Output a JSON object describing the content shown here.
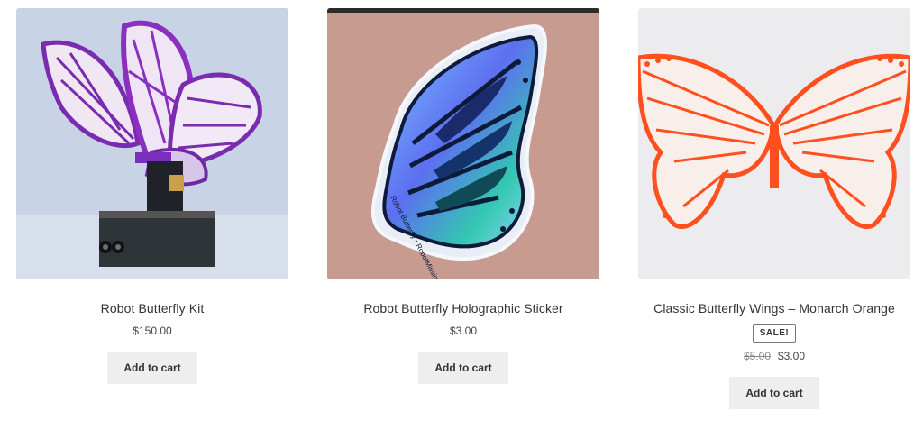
{
  "products": [
    {
      "title": "Robot Butterfly Kit",
      "price": "$150.00",
      "button_label": "Add to cart",
      "image_icon": "robot-butterfly-kit-photo"
    },
    {
      "title": "Robot Butterfly Holographic Sticker",
      "price": "$3.00",
      "button_label": "Add to cart",
      "image_icon": "holographic-sticker-photo",
      "sticker_text": "Robot Butterfly • RobotMissions.org • RobotZwrrl.xyz"
    },
    {
      "title": "Classic Butterfly Wings – Monarch Orange",
      "sale_badge": "SALE!",
      "original_price": "$5.00",
      "price": "$3.00",
      "button_label": "Add to cart",
      "image_icon": "monarch-orange-wings-photo"
    }
  ],
  "colors": {
    "button_bg": "#eeeeee",
    "wing_purple": "#8a2fbf",
    "wing_orange": "#ff4f1f",
    "sticker_blue": "#3a5fd6",
    "cardboard": "#c79b90"
  }
}
